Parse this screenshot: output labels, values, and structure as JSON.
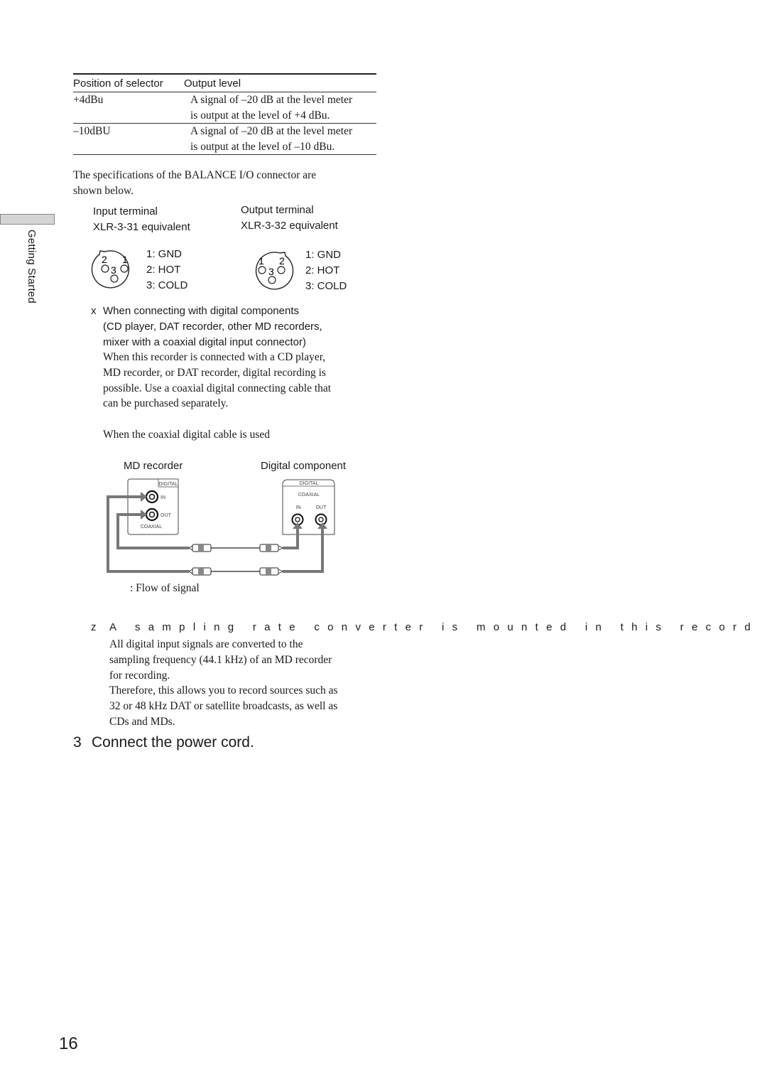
{
  "table": {
    "headers": [
      "Position of selector",
      "Output level"
    ],
    "rows": [
      {
        "position": "+4dBu",
        "line1": "A signal of –20 dB at the level meter",
        "line2": "is output at the level of +4 dBu."
      },
      {
        "position": "–10dBU",
        "line1": "A signal of –20 dB at the level meter",
        "line2": "is output at the level of –10 dBu."
      }
    ]
  },
  "balance_intro": {
    "line1": "The specifications of the BALANCE I/O connector are",
    "line2": "shown below."
  },
  "side_tab": {
    "label": "Getting Started"
  },
  "input_terminal": {
    "title": "Input terminal",
    "subtitle": "XLR-3-31 equivalent",
    "pin_numbers": [
      "2",
      "1",
      "3"
    ],
    "pins": [
      "1: GND",
      "2: HOT",
      "3: COLD"
    ]
  },
  "output_terminal": {
    "title": "Output terminal",
    "subtitle": "XLR-3-32 equivalent",
    "pin_numbers": [
      "1",
      "2",
      "3"
    ],
    "pins": [
      "1: GND",
      "2: HOT",
      "3: COLD"
    ]
  },
  "digital_section": {
    "bullet": "x",
    "heading": [
      "When connecting with digital components",
      "(CD player, DAT recorder, other MD recorders,",
      "mixer with a coaxial digital input connector)"
    ],
    "body": [
      "When this recorder is connected with a CD player,",
      "MD recorder, or DAT recorder, digital recording is",
      "possible.  Use a coaxial digital connecting cable that",
      "can be purchased separately."
    ],
    "cable_caption": "When the coaxial digital cable is used"
  },
  "diagram": {
    "left_device": "MD recorder",
    "right_device": "Digital component",
    "left_panel": {
      "header": "DIGITAL",
      "in": "IN",
      "out": "OUT",
      "footer": "COAXIAL"
    },
    "right_panel": {
      "header": "DIGITAL",
      "sub": "COAXIAL",
      "in": "IN",
      "out": "OUT"
    },
    "legend": ": Flow of signal"
  },
  "note": {
    "bullet": "z",
    "spaced_line": "A sampling rate converter is mounted in this record",
    "lines": [
      "All digital input signals are converted to the",
      "sampling frequency (44.1 kHz) of an MD  recorder",
      "for recording.",
      "Therefore, this allows you to record sources such as",
      "32 or 48 kHz DAT or satellite broadcasts, as well as",
      "CDs and MDs."
    ]
  },
  "step3": {
    "number": "3",
    "text": "Connect the power cord."
  },
  "page_number": "16"
}
